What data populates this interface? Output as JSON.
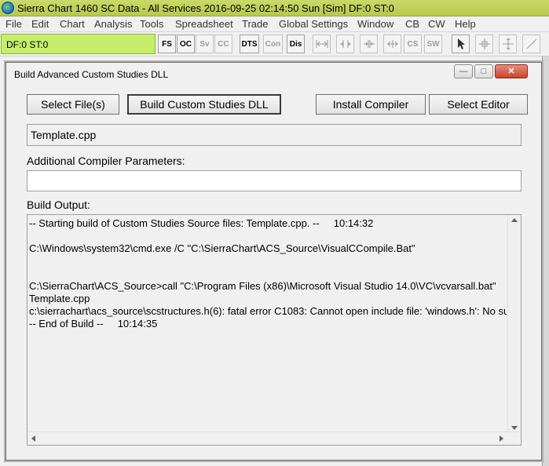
{
  "app": {
    "title": "Sierra Chart 1460 SC Data - All Services 2016-09-25  02:14:50 Sun [Sim]  DF:0  ST:0"
  },
  "menu": [
    "File",
    "Edit",
    "Chart",
    "Analysis",
    "Tools",
    "Spreadsheet",
    "Trade",
    "Global Settings",
    "Window",
    "CB",
    "CW",
    "Help"
  ],
  "toolbar": {
    "status": "DF:0  ST:0",
    "buttons": [
      {
        "label": "FS",
        "enabled": true
      },
      {
        "label": "OC",
        "enabled": true
      },
      {
        "label": "Sv",
        "enabled": false
      },
      {
        "label": "CC",
        "enabled": false
      },
      {
        "label": "DTS",
        "enabled": true
      },
      {
        "label": "Con",
        "enabled": false
      },
      {
        "label": "Dis",
        "enabled": true
      },
      {
        "label": "CS",
        "enabled": false
      },
      {
        "label": "SW",
        "enabled": false
      }
    ],
    "icons": [
      "bar-spacing-icon",
      "bar-spacing-increase-icon",
      "bar-spacing-decrease-icon",
      "bar-spacing-fit-icon",
      "pointer-icon",
      "crosshair-icon",
      "cursor-line-icon",
      "draw-line-icon"
    ]
  },
  "dialog": {
    "title": "Build Advanced Custom Studies DLL",
    "buttons": {
      "select_files": "Select File(s)",
      "build_dll": "Build Custom Studies DLL",
      "install_compiler": "Install Compiler",
      "select_editor": "Select Editor"
    },
    "selected_file": "Template.cpp",
    "params_label": "Additional Compiler Parameters:",
    "params_value": "",
    "output_label": "Build Output:",
    "output_text": "-- Starting build of Custom Studies Source files: Template.cpp. --     10:14:32\n\nC:\\Windows\\system32\\cmd.exe /C \"C:\\SierraChart\\ACS_Source\\VisualCCompile.Bat\"\n\n\nC:\\SierraChart\\ACS_Source>call \"C:\\Program Files (x86)\\Microsoft Visual Studio 14.0\\VC\\vcvarsall.bat\"\nTemplate.cpp\nc:\\sierrachart\\acs_source\\scstructures.h(6): fatal error C1083: Cannot open include file: 'windows.h': No such file or directory\n-- End of Build --     10:14:35"
  }
}
